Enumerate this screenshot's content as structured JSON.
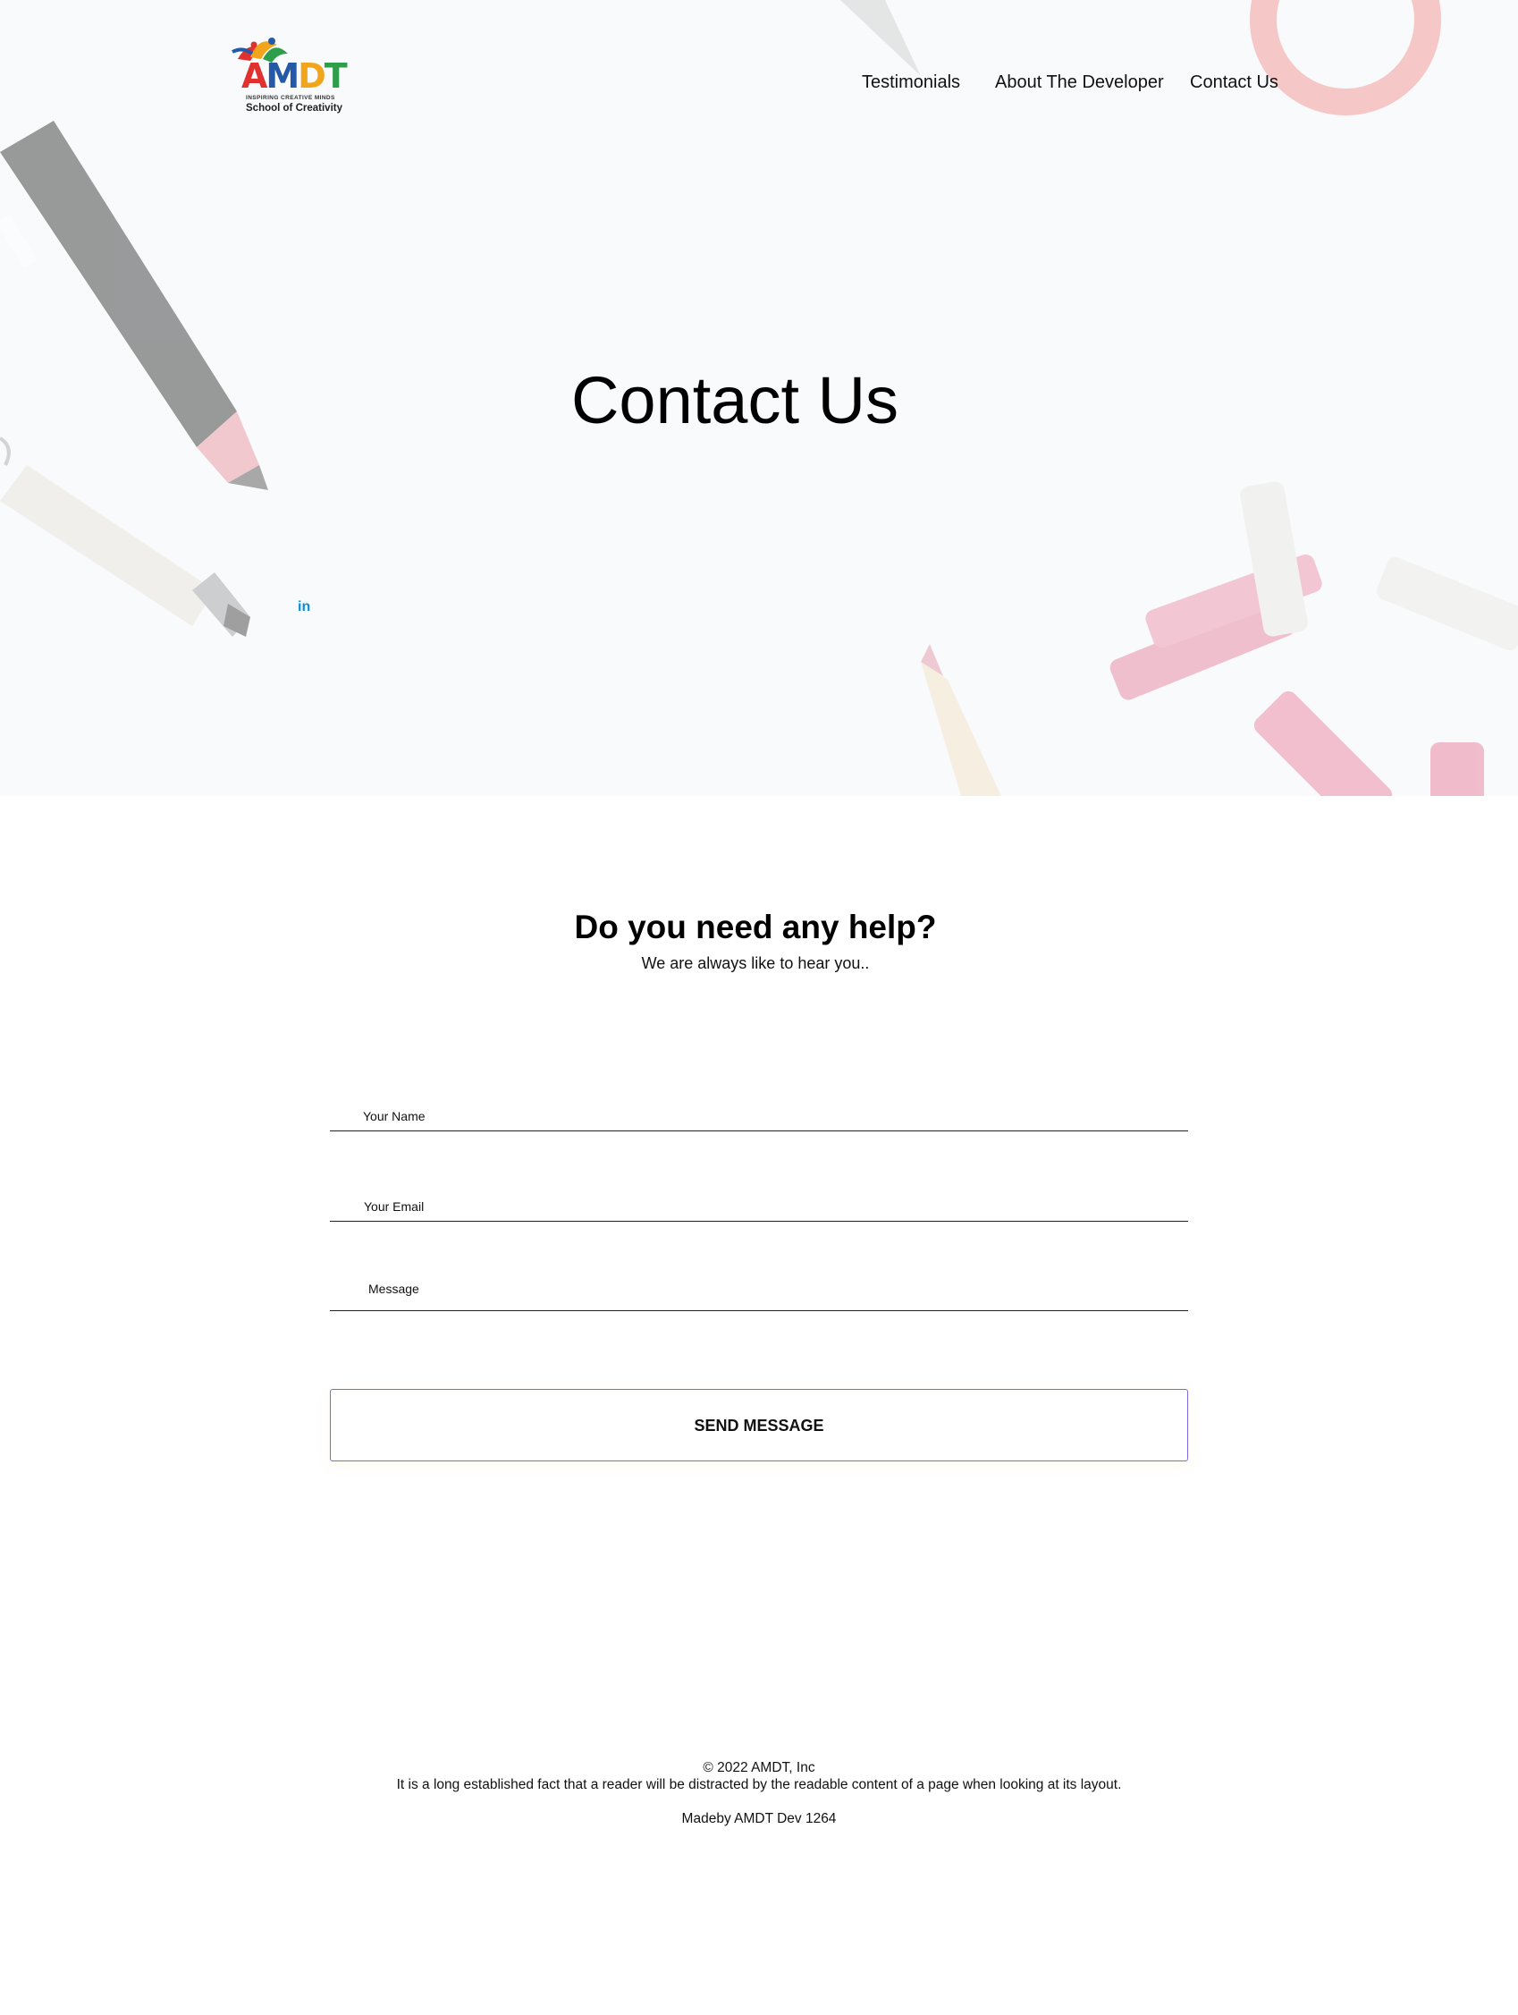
{
  "logo": {
    "word": [
      "A",
      "M",
      "D",
      "T"
    ],
    "tagline": "INSPIRING CREATIVE MINDS",
    "subtitle": "School of Creativity"
  },
  "nav": {
    "items": [
      {
        "label": "Testimonials"
      },
      {
        "label": "About The Developer"
      },
      {
        "label": "Contact Us"
      }
    ]
  },
  "hero": {
    "title": "Contact Us",
    "social_icon": "linkedin-icon",
    "social_label": "in"
  },
  "help": {
    "title": "Do you need any help?",
    "subtitle": "We are always like to hear you.."
  },
  "form": {
    "name_placeholder": "Your Name",
    "email_placeholder": "Your Email",
    "message_placeholder": "Message",
    "submit_label": "SEND MESSAGE"
  },
  "footer": {
    "copyright": "© 2022 AMDT, Inc",
    "text": "It is a long established fact that a reader will be distracted by the readable content of a page when looking at its layout.",
    "credit": "Madeby AMDT Dev 1264"
  },
  "colors": {
    "hero_bg": "#f9fafc",
    "button_border": "#7f69e0",
    "linkedin": "#0a8fd6"
  }
}
